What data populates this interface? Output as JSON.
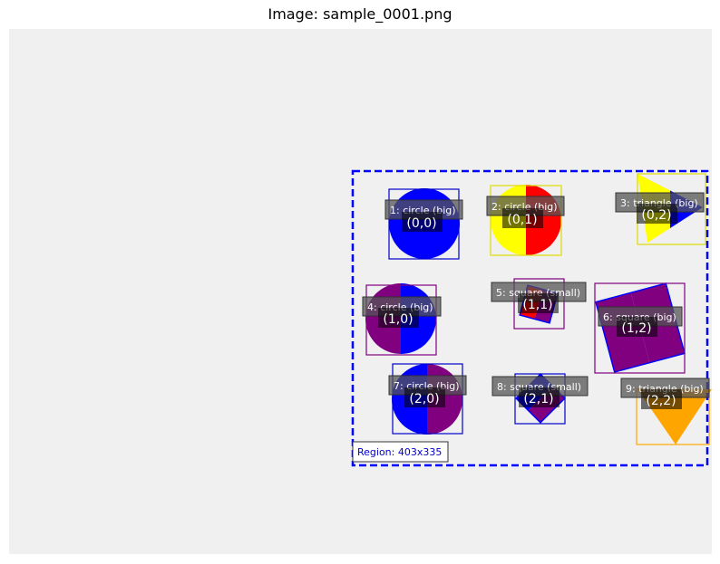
{
  "title": "Image: sample_0001.png",
  "colors": {
    "canvas_bg": "#f0f0f0",
    "region_border": "#0000ff",
    "label_bg": "#555555",
    "coord_bg": "#000000"
  },
  "region": {
    "label": "Region: 403x335"
  },
  "shapes": [
    {
      "id": 1,
      "label": "1: circle (big)",
      "coord": "(0,0)",
      "kind": "circle",
      "size": "big",
      "fill_left": "#0000ff",
      "fill_right": "#0000ff",
      "box_color": "#0000cc"
    },
    {
      "id": 2,
      "label": "2: circle (big)",
      "coord": "(0,1)",
      "kind": "circle",
      "size": "big",
      "fill_left": "#ffff00",
      "fill_right": "#ff0000",
      "box_color": "#dddd00"
    },
    {
      "id": 3,
      "label": "3: triangle (big)",
      "coord": "(0,2)",
      "kind": "triangle",
      "size": "big",
      "fill_left": "#ffff00",
      "fill_right": "#0000ff",
      "box_color": "#dddd00"
    },
    {
      "id": 4,
      "label": "4: circle (big)",
      "coord": "(1,0)",
      "kind": "circle",
      "size": "big",
      "fill_left": "#800080",
      "fill_right": "#0000ff",
      "box_color": "#800080"
    },
    {
      "id": 5,
      "label": "5: square (small)",
      "coord": "(1,1)",
      "kind": "square",
      "size": "small",
      "fill_left": "#ff0000",
      "fill_right": "#800080",
      "box_color": "#800080"
    },
    {
      "id": 6,
      "label": "6: square (big)",
      "coord": "(1,2)",
      "kind": "square",
      "size": "big",
      "fill_left": "#800080",
      "fill_right": "#800080",
      "box_color": "#800080"
    },
    {
      "id": 7,
      "label": "7: circle (big)",
      "coord": "(2,0)",
      "kind": "circle",
      "size": "big",
      "fill_left": "#0000ff",
      "fill_right": "#800080",
      "box_color": "#0000cc"
    },
    {
      "id": 8,
      "label": "8: square (small)",
      "coord": "(2,1)",
      "kind": "square",
      "size": "small",
      "fill_left": "#0000ff",
      "fill_right": "#800080",
      "box_color": "#0000cc"
    },
    {
      "id": 9,
      "label": "9: triangle (big)",
      "coord": "(2,2)",
      "kind": "triangle",
      "size": "big",
      "fill_left": "#ffa500",
      "fill_right": "#ffa500",
      "box_color": "#ffa500"
    }
  ]
}
